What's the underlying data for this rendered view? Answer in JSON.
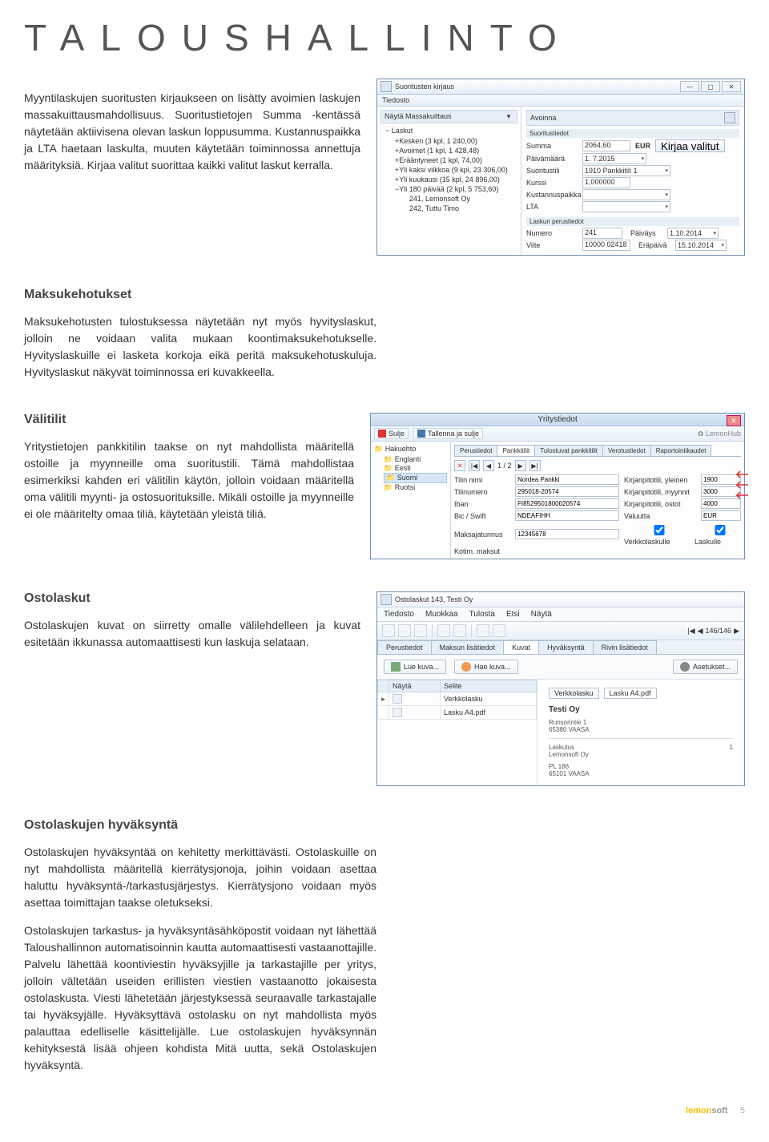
{
  "page": {
    "title": "TALOUSHALLINTO",
    "page_number": "5",
    "brand_a": "lemon",
    "brand_b": "soft"
  },
  "sections": {
    "intro": "Myyntilaskujen suoritusten kirjaukseen on lisätty avoimien laskujen massakuittausmahdollisuus. Suoritustietojen Summa -kentässä näytetään aktiivisena olevan laskun loppusumma. Kustannuspaikka ja LTA haetaan laskulta, muuten käytetään toiminnossa annettuja määrityksiä. Kirjaa valitut suorittaa kaikki valitut laskut kerralla.",
    "maksukehotukset": {
      "heading": "Maksukehotukset",
      "body": "Maksukehotusten tulostuksessa näytetään nyt myös hyvityslaskut, jolloin ne voidaan valita mukaan koontimaksukehotukselle. Hyvityslaskuille ei lasketa korkoja eikä peritä maksukehotuskuluja. Hyvityslaskut näkyvät toiminnossa eri kuvakkeella."
    },
    "valitilit": {
      "heading": "Välitilit",
      "body": "Yritystietojen pankkitilin taakse on nyt mahdollista määritellä ostoille ja myynneille oma suoritustili. Tämä mahdollistaa esimerkiksi kahden eri välitilin käytön, jolloin voidaan määritellä oma välitili myynti- ja ostosuorituksille. Mikäli ostoille ja myynneille ei ole määritelty omaa tiliä, käytetään yleistä tiliä."
    },
    "ostolaskut": {
      "heading": "Ostolaskut",
      "body": "Ostolaskujen kuvat on siirretty omalle välilehdelleen ja kuvat esitetään ikkunassa automaattisesti kun laskuja selataan."
    },
    "hyvaksynta": {
      "heading": "Ostolaskujen hyväksyntä",
      "body1": "Ostolaskujen hyväksyntää on kehitetty merkittävästi. Ostolaskuille on nyt mahdollista määritellä kierrätysjonoja, joihin voidaan asettaa haluttu hyväksyntä-/tarkastusjärjestys. Kierrätysjono voidaan myös asettaa toimittajan taakse oletukseksi.",
      "body2": "Ostolaskujen tarkastus- ja hyväksyntäsähköpostit voidaan nyt lähettää Taloushallinnon automatisoinnin kautta automaattisesti vastaanottajille. Palvelu lähettää koontiviestin hyväksyjille ja tarkastajille per yritys, jolloin vältetään useiden erillisten viestien vastaanotto jokaisesta ostolaskusta. Viesti lähetetään järjestyksessä seuraavalle tarkastajalle tai hyväksyjälle. Hyväksyttävä ostolasku on nyt mahdollista myös palauttaa edelliselle käsittelijälle. Lue ostolaskujen hyväksynnän kehityksestä lisää ohjeen kohdista Mitä uutta, sekä Ostolaskujen hyväksyntä."
    }
  },
  "screenshot1": {
    "window_title": "Suoritusten kirjaus",
    "menu_tiedosto": "Tiedosto",
    "left_header": "Näytä Massakuittaus",
    "right_header": "Avoinna",
    "tree_root": "Laskut",
    "tree": [
      "Kesken (3 kpl, 1 240,00)",
      "Avoimet (1 kpl, 1 428,48)",
      "Erääntyneet (1 kpl, 74,00)",
      "Yli kaksi viikkoa (9 kpl, 23 306,00)",
      "Yli kuukausi (15 kpl, 24 896,00)",
      "Yli 180 päivää (2 kpl, 5 753,60)"
    ],
    "tree_leaves": [
      "241, Lemonsoft Oy",
      "242, Tuttu Timo"
    ],
    "form_header": "Suoritustiedot",
    "fields": {
      "summa_label": "Summa",
      "summa_value": "2064,60",
      "currency": "EUR",
      "kirjaa_btn": "Kirjaa valitut",
      "paivamaara_label": "Päivämäärä",
      "paivamaara_value": "1. 7.2015",
      "suoritustili_label": "Suoritustili",
      "suoritustili_value": "1910 Pankkitili 1",
      "kurssi_label": "Kurssi",
      "kurssi_value": "1,000000",
      "kustannuspaikka_label": "Kustannuspaikka",
      "lta_label": "LTA"
    },
    "section2_header": "Laskun perustiedot",
    "fields2": {
      "numero_label": "Numero",
      "numero_value": "241",
      "paivays_label": "Päiväys",
      "paivays_value": "1.10.2014",
      "viite_label": "Viite",
      "viite_value": "10000 02418",
      "erapaiva_label": "Eräpäivä",
      "erapaiva_value": "15.10.2014"
    }
  },
  "screenshot2": {
    "window_title": "Yritystiedot",
    "btn_sulje": "Sulje",
    "btn_tallenna": "Tallenna ja sulje",
    "brand": "LemonHub",
    "tree_root": "Hakuehto",
    "countries": [
      "Englanti",
      "Eesti",
      "Suomi",
      "Ruotsi"
    ],
    "selected_country": "Suomi",
    "tabs": [
      "Perustiedot",
      "Pankkitilit",
      "Tulostuvat pankkitilit",
      "Verotustiedot",
      "Raportointikaudet"
    ],
    "active_tab": "Pankkitilit",
    "nav_pos": "1 / 2",
    "grid": {
      "tilin_nimi": {
        "label": "Tilin nimi",
        "value": "Nordea Pankki"
      },
      "tilinumero": {
        "label": "Tilinumero",
        "value": "295018-20574"
      },
      "iban": {
        "label": "Iban",
        "value": "FI8529501800020574"
      },
      "bic": {
        "label": "Bic / Swift",
        "value": "NDEAFIHH"
      },
      "maksajatunnus": {
        "label": "Maksajatunnus",
        "value": "12345678"
      },
      "kotim": {
        "label": "Kotim. maksut"
      },
      "kp_yleinen": {
        "label": "Kirjanpitotili, yleinen",
        "value": "1900"
      },
      "kp_myynnit": {
        "label": "Kirjanpitotili, myynnit",
        "value": "3000"
      },
      "kp_ostot": {
        "label": "Kirjanpitotili, ostot",
        "value": "4000"
      },
      "valuutta": {
        "label": "Valuutta",
        "value": "EUR"
      },
      "verkkolaskulle": "Verkkolaskulle",
      "laskulle": "Laskulle"
    }
  },
  "screenshot3": {
    "window_title": "Ostolaskut 143, Testi Oy",
    "menu": [
      "Tiedosto",
      "Muokkaa",
      "Tulosta",
      "Etsi",
      "Näytä"
    ],
    "nav": "146/146",
    "tabs": [
      "Perustiedot",
      "Maksun lisätiedot",
      "Kuvat",
      "Hyväksyntä",
      "Rivin lisätiedot"
    ],
    "active_tab": "Kuvat",
    "btn_lue": "Lue kuva...",
    "btn_hae": "Hae kuva...",
    "btn_asetukset": "Asetukset...",
    "grid_headers": [
      "Näytä",
      "Selite"
    ],
    "grid_rows": [
      "Verkkolasku",
      "Lasku A4.pdf"
    ],
    "preview_file": "Lasku A4.pdf",
    "preview": {
      "company": "Testi Oy",
      "addr1": "Runsorintie 1",
      "addr2": "65380 VAASA",
      "laskutus_label": "Laskutus",
      "laskutus_num": "1",
      "vendor": "Lemonsoft Oy",
      "pl": "PL 186",
      "city": "65101 VAASA"
    }
  }
}
